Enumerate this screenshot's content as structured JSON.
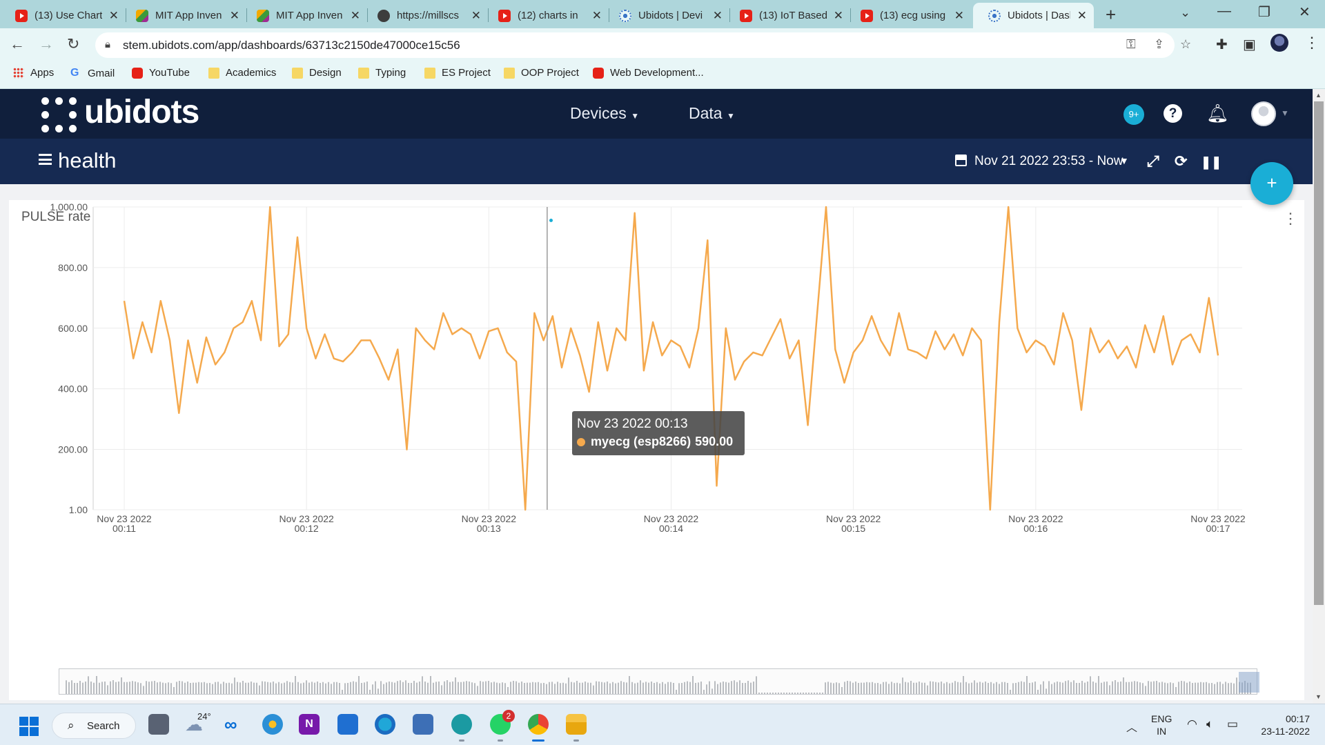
{
  "browser": {
    "tabs": [
      {
        "title": "(13) Use Chart",
        "favicon": "youtube-icon"
      },
      {
        "title": "MIT App Inven",
        "favicon": "mit-app-inventor-icon"
      },
      {
        "title": "MIT App Inven",
        "favicon": "mit-app-inventor-icon"
      },
      {
        "title": "https://millscs",
        "favicon": "globe-icon"
      },
      {
        "title": "(12) charts in",
        "favicon": "youtube-icon"
      },
      {
        "title": "Ubidots | Devi",
        "favicon": "ubidots-icon"
      },
      {
        "title": "(13) IoT Based",
        "favicon": "youtube-icon"
      },
      {
        "title": "(13) ecg using",
        "favicon": "youtube-icon"
      },
      {
        "title": "Ubidots | Dash",
        "favicon": "ubidots-icon",
        "active": true
      }
    ],
    "url": "stem.ubidots.com/app/dashboards/63713c2150de47000ce15c56",
    "bookmarks": [
      "Apps",
      "Gmail",
      "YouTube",
      "Academics",
      "Design",
      "Typing",
      "ES Project",
      "OOP Project",
      "Web Development..."
    ]
  },
  "app": {
    "logo": "ubidots",
    "nav": {
      "devices": "Devices",
      "data": "Data"
    },
    "notifications_badge": "9+",
    "dashboard_title": "health",
    "date_range": "Nov 21 2022 23:53 - Now",
    "fab_label": "+"
  },
  "widget": {
    "title": "PULSE rate",
    "tooltip": {
      "time": "Nov 23 2022 00:13",
      "series": "myecg (esp8266)",
      "value": "590.00"
    }
  },
  "chart_data": {
    "type": "line",
    "title": "PULSE rate",
    "ylim": [
      1,
      1000
    ],
    "yticks": [
      "1,000.00",
      "800.00",
      "600.00",
      "400.00",
      "200.00",
      "1.00"
    ],
    "ytick_values": [
      1000,
      800,
      600,
      400,
      200,
      1
    ],
    "xticks": [
      {
        "date": "Nov 23 2022",
        "time": "00:11"
      },
      {
        "date": "Nov 23 2022",
        "time": "00:12"
      },
      {
        "date": "Nov 23 2022",
        "time": "00:13"
      },
      {
        "date": "Nov 23 2022",
        "time": "00:14"
      },
      {
        "date": "Nov 23 2022",
        "time": "00:15"
      },
      {
        "date": "Nov 23 2022",
        "time": "00:16"
      },
      {
        "date": "Nov 23 2022",
        "time": "00:17"
      }
    ],
    "series": [
      {
        "name": "myecg (esp8266)",
        "color": "#f5a94d",
        "x": [
          0,
          0.05,
          0.1,
          0.15,
          0.2,
          0.25,
          0.3,
          0.35,
          0.4,
          0.45,
          0.5,
          0.55,
          0.6,
          0.65,
          0.7,
          0.75,
          0.8,
          0.85,
          0.9,
          0.95,
          1.0,
          1.05,
          1.1,
          1.15,
          1.2,
          1.25,
          1.3,
          1.35,
          1.4,
          1.45,
          1.5,
          1.55,
          1.6,
          1.65,
          1.7,
          1.75,
          1.8,
          1.85,
          1.9,
          1.95,
          2.0,
          2.05,
          2.1,
          2.15,
          2.2,
          2.25,
          2.3,
          2.35,
          2.4,
          2.45,
          2.5,
          2.55,
          2.6,
          2.65,
          2.7,
          2.75,
          2.8,
          2.85,
          2.9,
          2.95,
          3.0,
          3.05,
          3.1,
          3.15,
          3.2,
          3.25,
          3.3,
          3.35,
          3.4,
          3.45,
          3.5,
          3.55,
          3.6,
          3.65,
          3.7,
          3.75,
          3.8,
          3.85,
          3.9,
          3.95,
          4.0,
          4.05,
          4.1,
          4.15,
          4.2,
          4.25,
          4.3,
          4.35,
          4.4,
          4.45,
          4.5,
          4.55,
          4.6,
          4.65,
          4.7,
          4.75,
          4.8,
          4.85,
          4.9,
          4.95,
          5.0,
          5.05,
          5.1,
          5.15,
          5.2,
          5.25,
          5.3,
          5.35,
          5.4,
          5.45,
          5.5,
          5.55,
          5.6,
          5.65,
          5.7,
          5.75,
          5.8,
          5.85,
          5.9,
          5.95,
          6.0
        ],
        "values": [
          690,
          500,
          620,
          520,
          690,
          560,
          320,
          560,
          420,
          570,
          480,
          520,
          600,
          620,
          690,
          560,
          1000,
          540,
          580,
          900,
          600,
          500,
          580,
          500,
          490,
          520,
          560,
          560,
          500,
          430,
          530,
          200,
          600,
          560,
          530,
          650,
          580,
          600,
          580,
          500,
          590,
          600,
          520,
          490,
          1,
          650,
          560,
          640,
          470,
          600,
          510,
          390,
          620,
          460,
          600,
          560,
          980,
          460,
          620,
          510,
          560,
          540,
          470,
          600,
          890,
          80,
          600,
          430,
          490,
          520,
          510,
          570,
          630,
          500,
          560,
          280,
          640,
          1000,
          530,
          420,
          520,
          560,
          640,
          560,
          510,
          650,
          530,
          520,
          500,
          590,
          530,
          580,
          510,
          600,
          560,
          1,
          620,
          1000,
          600,
          520,
          560,
          540,
          480,
          650,
          560,
          330,
          600,
          520,
          560,
          500,
          540,
          470,
          610,
          520,
          640,
          480,
          560,
          580,
          520,
          700,
          510
        ]
      }
    ]
  },
  "taskbar": {
    "search": "Search",
    "weather": "24°",
    "whatsapp_badge": "2",
    "lang": [
      "ENG",
      "IN"
    ],
    "time": "00:17",
    "date": "23-11-2022"
  }
}
